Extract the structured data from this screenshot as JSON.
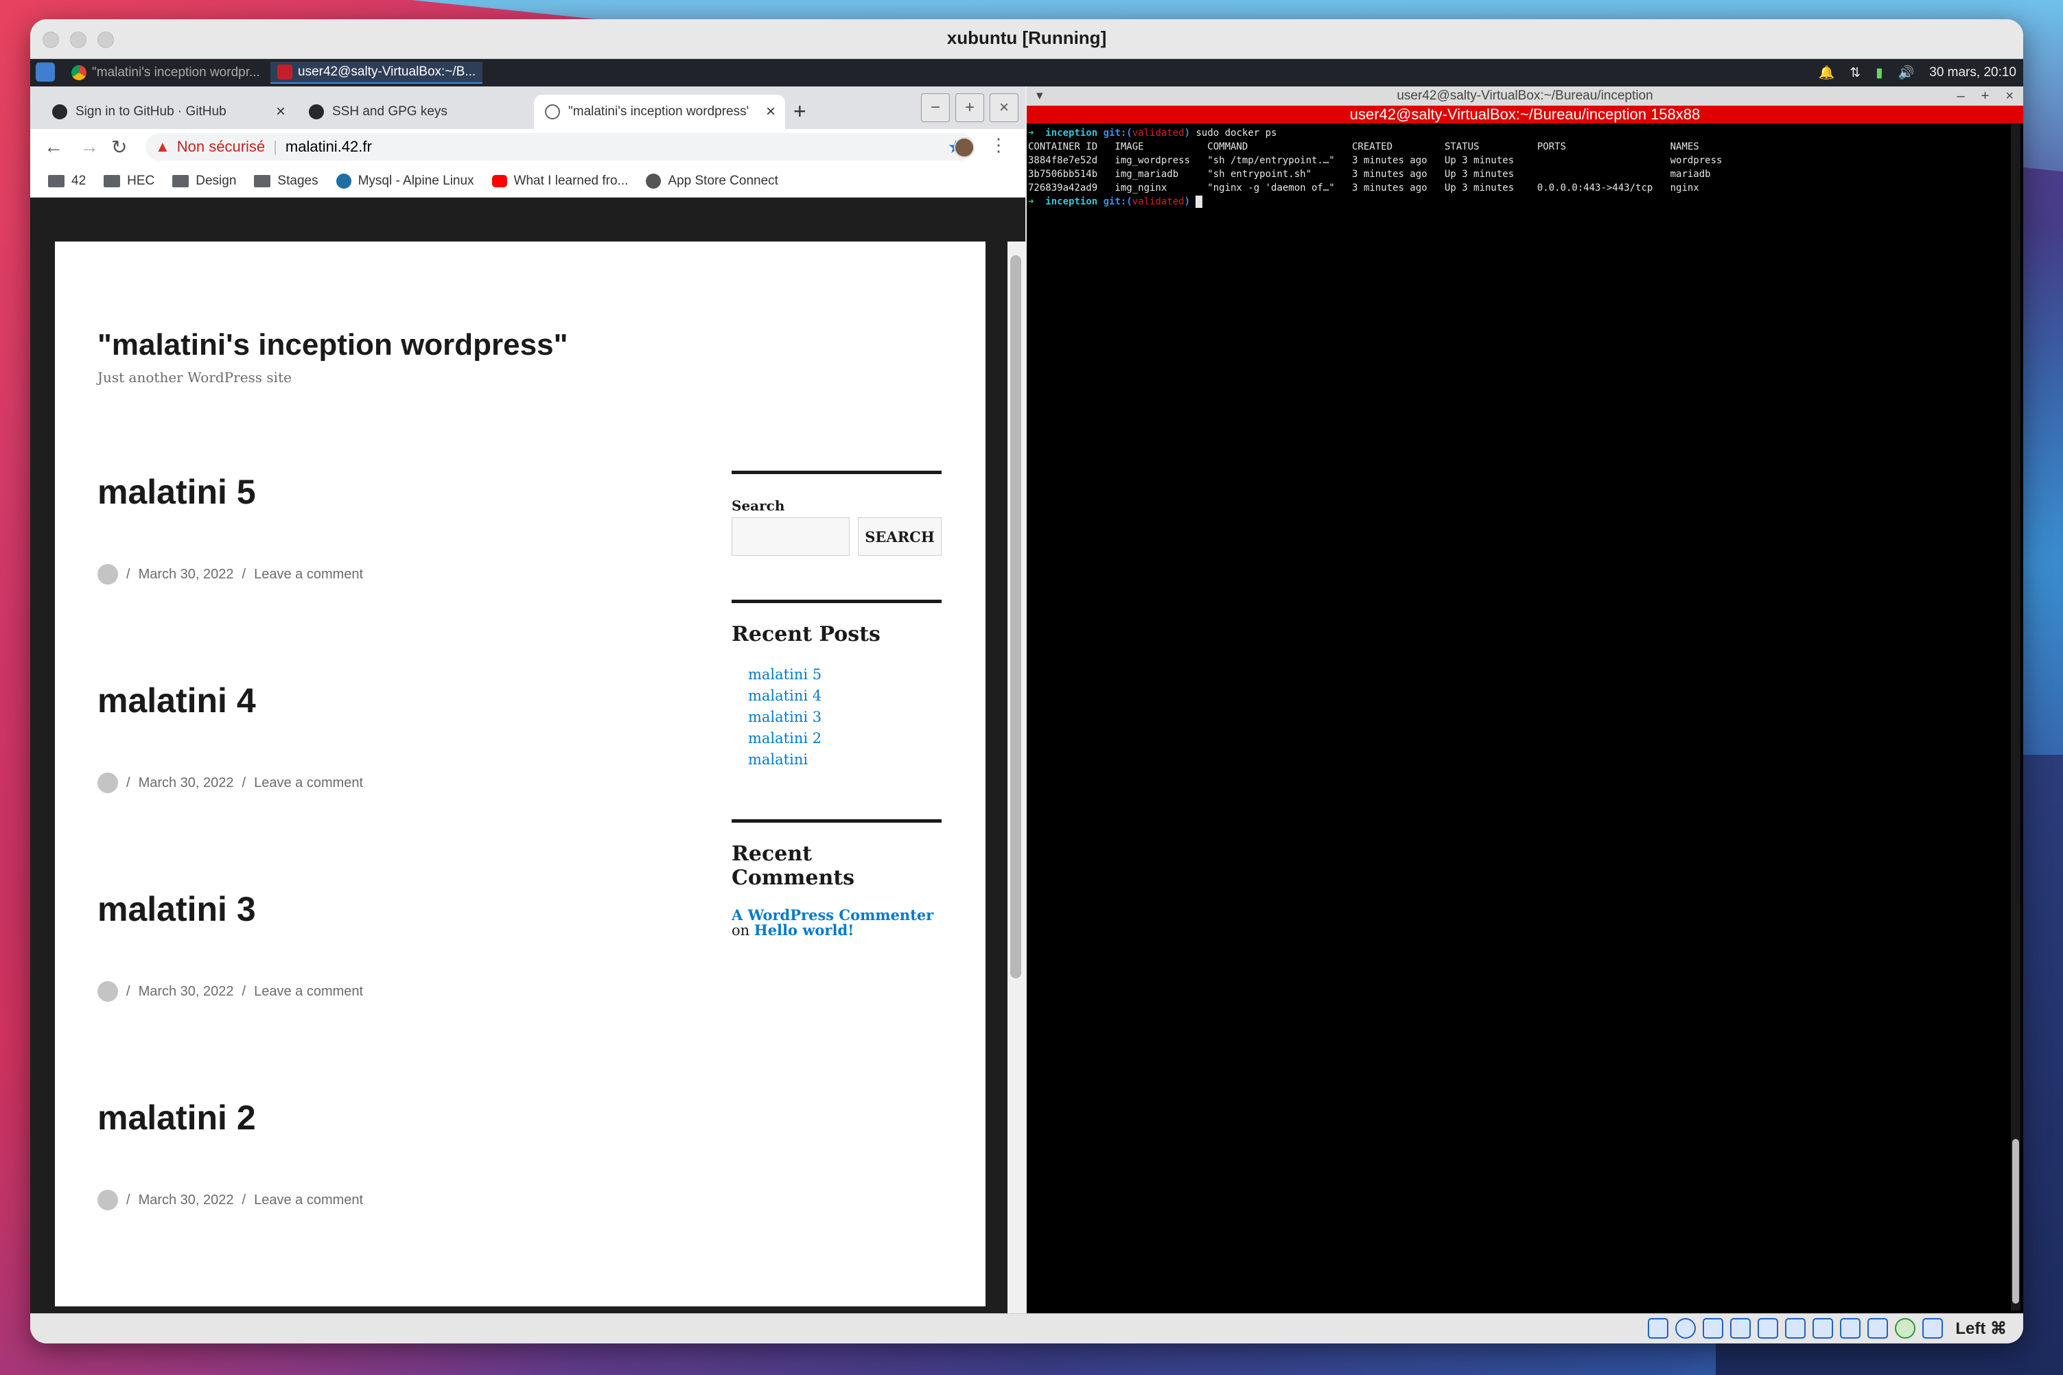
{
  "vm": {
    "title": "xubuntu [Running]",
    "host_key": "Left ⌘"
  },
  "panel": {
    "tasks": [
      {
        "label": "\"malatini's inception wordpr..."
      },
      {
        "label": "user42@salty-VirtualBox:~/B..."
      }
    ],
    "clock": "30 mars, 20:10"
  },
  "chrome": {
    "tabs": [
      {
        "label": "Sign in to GitHub · GitHub"
      },
      {
        "label": "SSH and GPG keys"
      },
      {
        "label": "\"malatini's inception wordpress\""
      }
    ],
    "security": "Non sécurisé",
    "url": "malatini.42.fr",
    "bookmarks": [
      {
        "label": "42"
      },
      {
        "label": "HEC"
      },
      {
        "label": "Design"
      },
      {
        "label": "Stages"
      },
      {
        "label": "Mysql - Alpine Linux"
      },
      {
        "label": "What I learned fro..."
      },
      {
        "label": "App Store Connect"
      }
    ]
  },
  "site": {
    "title": "\"malatini's inception wordpress\"",
    "tagline": "Just another WordPress site",
    "posts": [
      {
        "title": "malatini 5",
        "date": "March 30, 2022",
        "comment": "Leave a comment"
      },
      {
        "title": "malatini 4",
        "date": "March 30, 2022",
        "comment": "Leave a comment"
      },
      {
        "title": "malatini 3",
        "date": "March 30, 2022",
        "comment": "Leave a comment"
      },
      {
        "title": "malatini 2",
        "date": "March 30, 2022",
        "comment": "Leave a comment"
      }
    ],
    "search_label": "Search",
    "search_button": "SEARCH",
    "recent_posts_title": "Recent Posts",
    "recent_posts": [
      "malatini 5",
      "malatini 4",
      "malatini 3",
      "malatini 2",
      "malatini"
    ],
    "recent_comments_title": "Recent Comments",
    "comment_author": "A WordPress Commenter",
    "comment_on": "on",
    "comment_post": "Hello world!"
  },
  "terminal": {
    "window_title": "user42@salty-VirtualBox:~/Bureau/inception",
    "bar_title": "user42@salty-VirtualBox:~/Bureau/inception 158x88",
    "prompt_dir": "inception",
    "prompt_git": "git:(",
    "prompt_branch": "validated",
    "prompt_close": ")",
    "command": "sudo docker ps",
    "header": "CONTAINER ID   IMAGE           COMMAND                  CREATED         STATUS          PORTS                  NAMES",
    "rows": [
      "3884f8e7e52d   img_wordpress   \"sh /tmp/entrypoint.…\"   3 minutes ago   Up 3 minutes                           wordpress",
      "3b7506bb514b   img_mariadb     \"sh entrypoint.sh\"       3 minutes ago   Up 3 minutes                           mariadb",
      "726839a42ad9   img_nginx       \"nginx -g 'daemon of…\"   3 minutes ago   Up 3 minutes    0.0.0.0:443->443/tcp   nginx"
    ]
  }
}
